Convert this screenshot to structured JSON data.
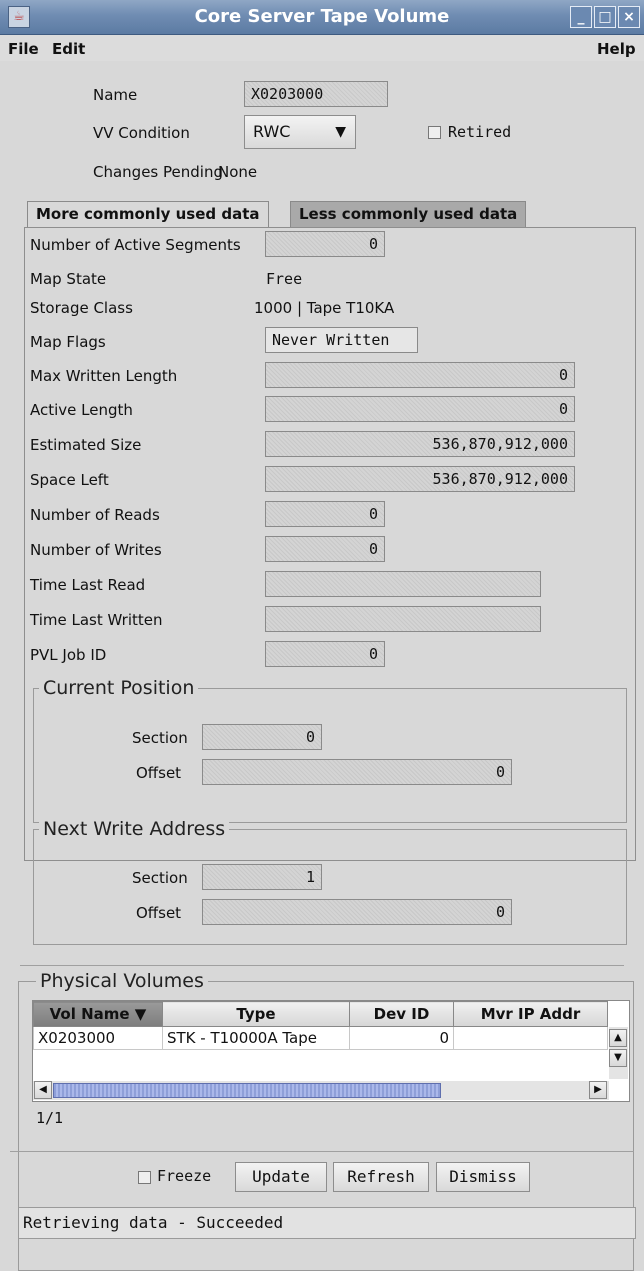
{
  "window": {
    "title": "Core Server Tape Volume",
    "icon": "java-app-icon"
  },
  "menu": {
    "file": "File",
    "edit": "Edit",
    "help": "Help"
  },
  "header": {
    "name_label": "Name",
    "name_value": "X0203000",
    "condition_label": "VV Condition",
    "condition_value": "RWC",
    "retired_label": "Retired",
    "retired_checked": false,
    "changes_label": "Changes Pending",
    "changes_value": "None"
  },
  "tabs": {
    "active": "More commonly used data",
    "inactive": "Less commonly used data"
  },
  "fields": {
    "active_segments": {
      "label": "Number of Active Segments",
      "value": "0"
    },
    "map_state": {
      "label": "Map State",
      "value": "Free"
    },
    "storage_class": {
      "label": "Storage Class",
      "value": "1000 | Tape T10KA"
    },
    "map_flags": {
      "label": "Map Flags",
      "value": "Never Written"
    },
    "max_written": {
      "label": "Max Written Length",
      "value": "0"
    },
    "active_length": {
      "label": "Active Length",
      "value": "0"
    },
    "estimated_size": {
      "label": "Estimated Size",
      "value": "536,870,912,000"
    },
    "space_left": {
      "label": "Space Left",
      "value": "536,870,912,000"
    },
    "reads": {
      "label": "Number of Reads",
      "value": "0"
    },
    "writes": {
      "label": "Number of Writes",
      "value": "0"
    },
    "last_read": {
      "label": "Time Last Read",
      "value": ""
    },
    "last_written": {
      "label": "Time Last Written",
      "value": ""
    },
    "pvl_job": {
      "label": "PVL Job ID",
      "value": "0"
    }
  },
  "current_position": {
    "title": "Current Position",
    "section_label": "Section",
    "section_value": "0",
    "offset_label": "Offset",
    "offset_value": "0"
  },
  "next_write": {
    "title": "Next Write Address",
    "section_label": "Section",
    "section_value": "1",
    "offset_label": "Offset",
    "offset_value": "0"
  },
  "physical_volumes": {
    "title": "Physical Volumes",
    "columns": [
      "Vol Name ▼",
      "Type",
      "Dev ID",
      "Mvr IP Addr"
    ],
    "rows": [
      [
        "X0203000",
        "STK - T10000A Tape",
        "0",
        ""
      ]
    ],
    "count": "1/1"
  },
  "buttons": {
    "freeze": "Freeze",
    "update": "Update",
    "refresh": "Refresh",
    "dismiss": "Dismiss"
  },
  "status": "Retrieving data - Succeeded"
}
